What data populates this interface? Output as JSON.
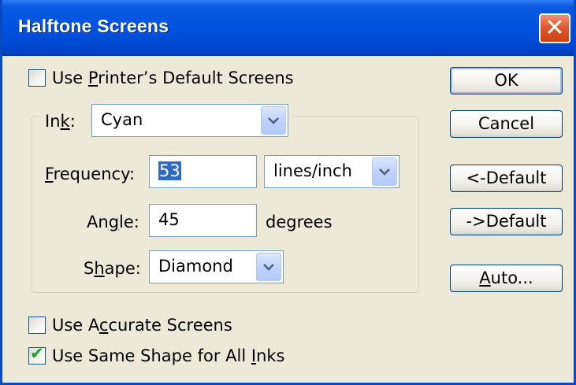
{
  "window": {
    "title": "Halftone Screens",
    "close_label": "✕"
  },
  "use_printer_default": {
    "checked": false,
    "label_pre": "Use ",
    "label_mnemonic": "P",
    "label_post": "rinter’s Default Screens"
  },
  "ink": {
    "label_pre": "In",
    "label_mnemonic": "k",
    "label_post": ":",
    "value": "Cyan"
  },
  "frequency": {
    "label_mnemonic": "F",
    "label_post": "requency:",
    "value": "53",
    "unit": "lines/inch"
  },
  "angle": {
    "label_pre": "An",
    "label_mnemonic": "g",
    "label_post": "le:",
    "value": "45",
    "unit": "degrees"
  },
  "shape": {
    "label_pre": "S",
    "label_mnemonic": "h",
    "label_post": "ape:",
    "value": "Diamond"
  },
  "use_accurate": {
    "checked": false,
    "label_pre": "Use A",
    "label_mnemonic": "c",
    "label_post": "curate Screens"
  },
  "use_same_shape": {
    "checked": true,
    "label_pre": "Use Same Shape for All ",
    "label_mnemonic": "I",
    "label_post": "nks"
  },
  "buttons": {
    "ok": "OK",
    "cancel": "Cancel",
    "load_default": "<-Default",
    "save_default": "->Default",
    "auto_mnemonic": "A",
    "auto_post": "uto..."
  },
  "colors": {
    "title_bar": "#0052df",
    "dialog_bg": "#ece9d8",
    "close_button": "#e05a30",
    "selection": "#316ac5",
    "check_mark": "#21a121"
  }
}
